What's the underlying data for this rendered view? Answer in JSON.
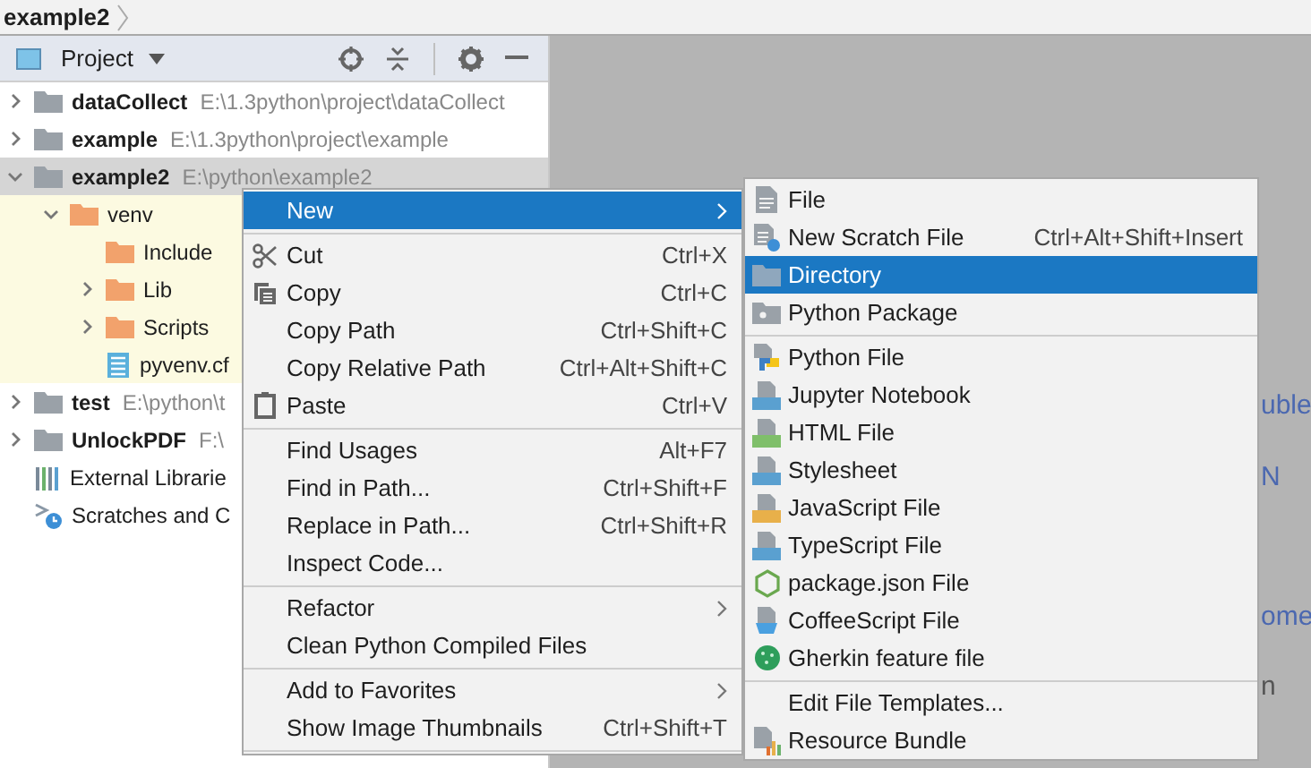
{
  "breadcrumb": {
    "label": "example2"
  },
  "toolbar": {
    "title": "Project"
  },
  "tree": [
    {
      "name": "dataCollect",
      "path": "E:\\1.3python\\project\\dataCollect",
      "kind": "project",
      "expanded": false,
      "selected": false
    },
    {
      "name": "example",
      "path": "E:\\1.3python\\project\\example",
      "kind": "project",
      "expanded": false,
      "selected": false
    },
    {
      "name": "example2",
      "path": "E:\\python\\example2",
      "kind": "project",
      "expanded": true,
      "selected": true,
      "children": [
        {
          "name": "venv",
          "kind": "folder",
          "expanded": true,
          "excluded": true,
          "selected": false,
          "children": [
            {
              "name": "Include",
              "kind": "folder",
              "selected": false
            },
            {
              "name": "Lib",
              "kind": "folder",
              "expanded": false,
              "selected": false
            },
            {
              "name": "Scripts",
              "kind": "folder",
              "expanded": false,
              "selected": false
            },
            {
              "name": "pyvenv.cf",
              "kind": "file",
              "selected": false
            }
          ]
        }
      ]
    },
    {
      "name": "test",
      "path": "E:\\python\\t",
      "kind": "project",
      "expanded": false,
      "selected": false
    },
    {
      "name": "UnlockPDF",
      "path": "F:\\",
      "kind": "project",
      "expanded": false,
      "selected": false
    },
    {
      "name": "External Librarie",
      "kind": "libraries",
      "selected": false
    },
    {
      "name": "Scratches and C",
      "kind": "scratches",
      "selected": false
    }
  ],
  "context_menu": {
    "items": [
      {
        "kind": "plain",
        "label": "New",
        "submenu": true,
        "selected": true
      },
      {
        "kind": "separator"
      },
      {
        "kind": "cut",
        "label": "Cut",
        "shortcut": "Ctrl+X",
        "selected": false
      },
      {
        "kind": "copy",
        "label": "Copy",
        "shortcut": "Ctrl+C",
        "selected": false
      },
      {
        "kind": "plain",
        "label": "Copy Path",
        "shortcut": "Ctrl+Shift+C",
        "selected": false
      },
      {
        "kind": "plain",
        "label": "Copy Relative Path",
        "shortcut": "Ctrl+Alt+Shift+C",
        "selected": false
      },
      {
        "kind": "paste",
        "label": "Paste",
        "shortcut": "Ctrl+V",
        "selected": false
      },
      {
        "kind": "separator"
      },
      {
        "kind": "plain",
        "label": "Find Usages",
        "shortcut": "Alt+F7",
        "selected": false
      },
      {
        "kind": "plain",
        "label": "Find in Path...",
        "shortcut": "Ctrl+Shift+F",
        "selected": false
      },
      {
        "kind": "plain",
        "label": "Replace in Path...",
        "shortcut": "Ctrl+Shift+R",
        "selected": false
      },
      {
        "kind": "plain",
        "label": "Inspect Code...",
        "selected": false
      },
      {
        "kind": "separator"
      },
      {
        "kind": "plain",
        "label": "Refactor",
        "submenu": true,
        "selected": false
      },
      {
        "kind": "plain",
        "label": "Clean Python Compiled Files",
        "selected": false
      },
      {
        "kind": "separator"
      },
      {
        "kind": "plain",
        "label": "Add to Favorites",
        "submenu": true,
        "selected": false
      },
      {
        "kind": "plain",
        "label": "Show Image Thumbnails",
        "shortcut": "Ctrl+Shift+T",
        "selected": false
      },
      {
        "kind": "separator"
      }
    ]
  },
  "new_submenu": {
    "items": [
      {
        "kind": "file",
        "label": "File",
        "selected": false
      },
      {
        "kind": "scratch",
        "label": "New Scratch File",
        "shortcut": "Ctrl+Alt+Shift+Insert",
        "selected": false
      },
      {
        "kind": "directory",
        "label": "Directory",
        "selected": true
      },
      {
        "kind": "package",
        "label": "Python Package",
        "selected": false
      },
      {
        "kind": "separator"
      },
      {
        "kind": "python",
        "label": "Python File",
        "selected": false
      },
      {
        "kind": "jupyter",
        "label": "Jupyter Notebook",
        "selected": false
      },
      {
        "kind": "html",
        "label": "HTML File",
        "selected": false
      },
      {
        "kind": "css",
        "label": "Stylesheet",
        "selected": false
      },
      {
        "kind": "js",
        "label": "JavaScript File",
        "selected": false
      },
      {
        "kind": "ts",
        "label": "TypeScript File",
        "selected": false
      },
      {
        "kind": "node",
        "label": "package.json File",
        "selected": false
      },
      {
        "kind": "coffee",
        "label": "CoffeeScript File",
        "selected": false
      },
      {
        "kind": "gherkin",
        "label": "Gherkin feature file",
        "selected": false
      },
      {
        "kind": "separator"
      },
      {
        "kind": "plain",
        "label": "Edit File Templates...",
        "selected": false
      },
      {
        "kind": "bundle",
        "label": "Resource Bundle",
        "selected": false
      }
    ]
  },
  "editor": {
    "hints": [
      {
        "text": "uble",
        "kind": "link"
      },
      {
        "text": "N",
        "kind": "link"
      },
      {
        "text": "ome",
        "kind": "link"
      },
      {
        "text": "n",
        "kind": "plain"
      }
    ]
  }
}
